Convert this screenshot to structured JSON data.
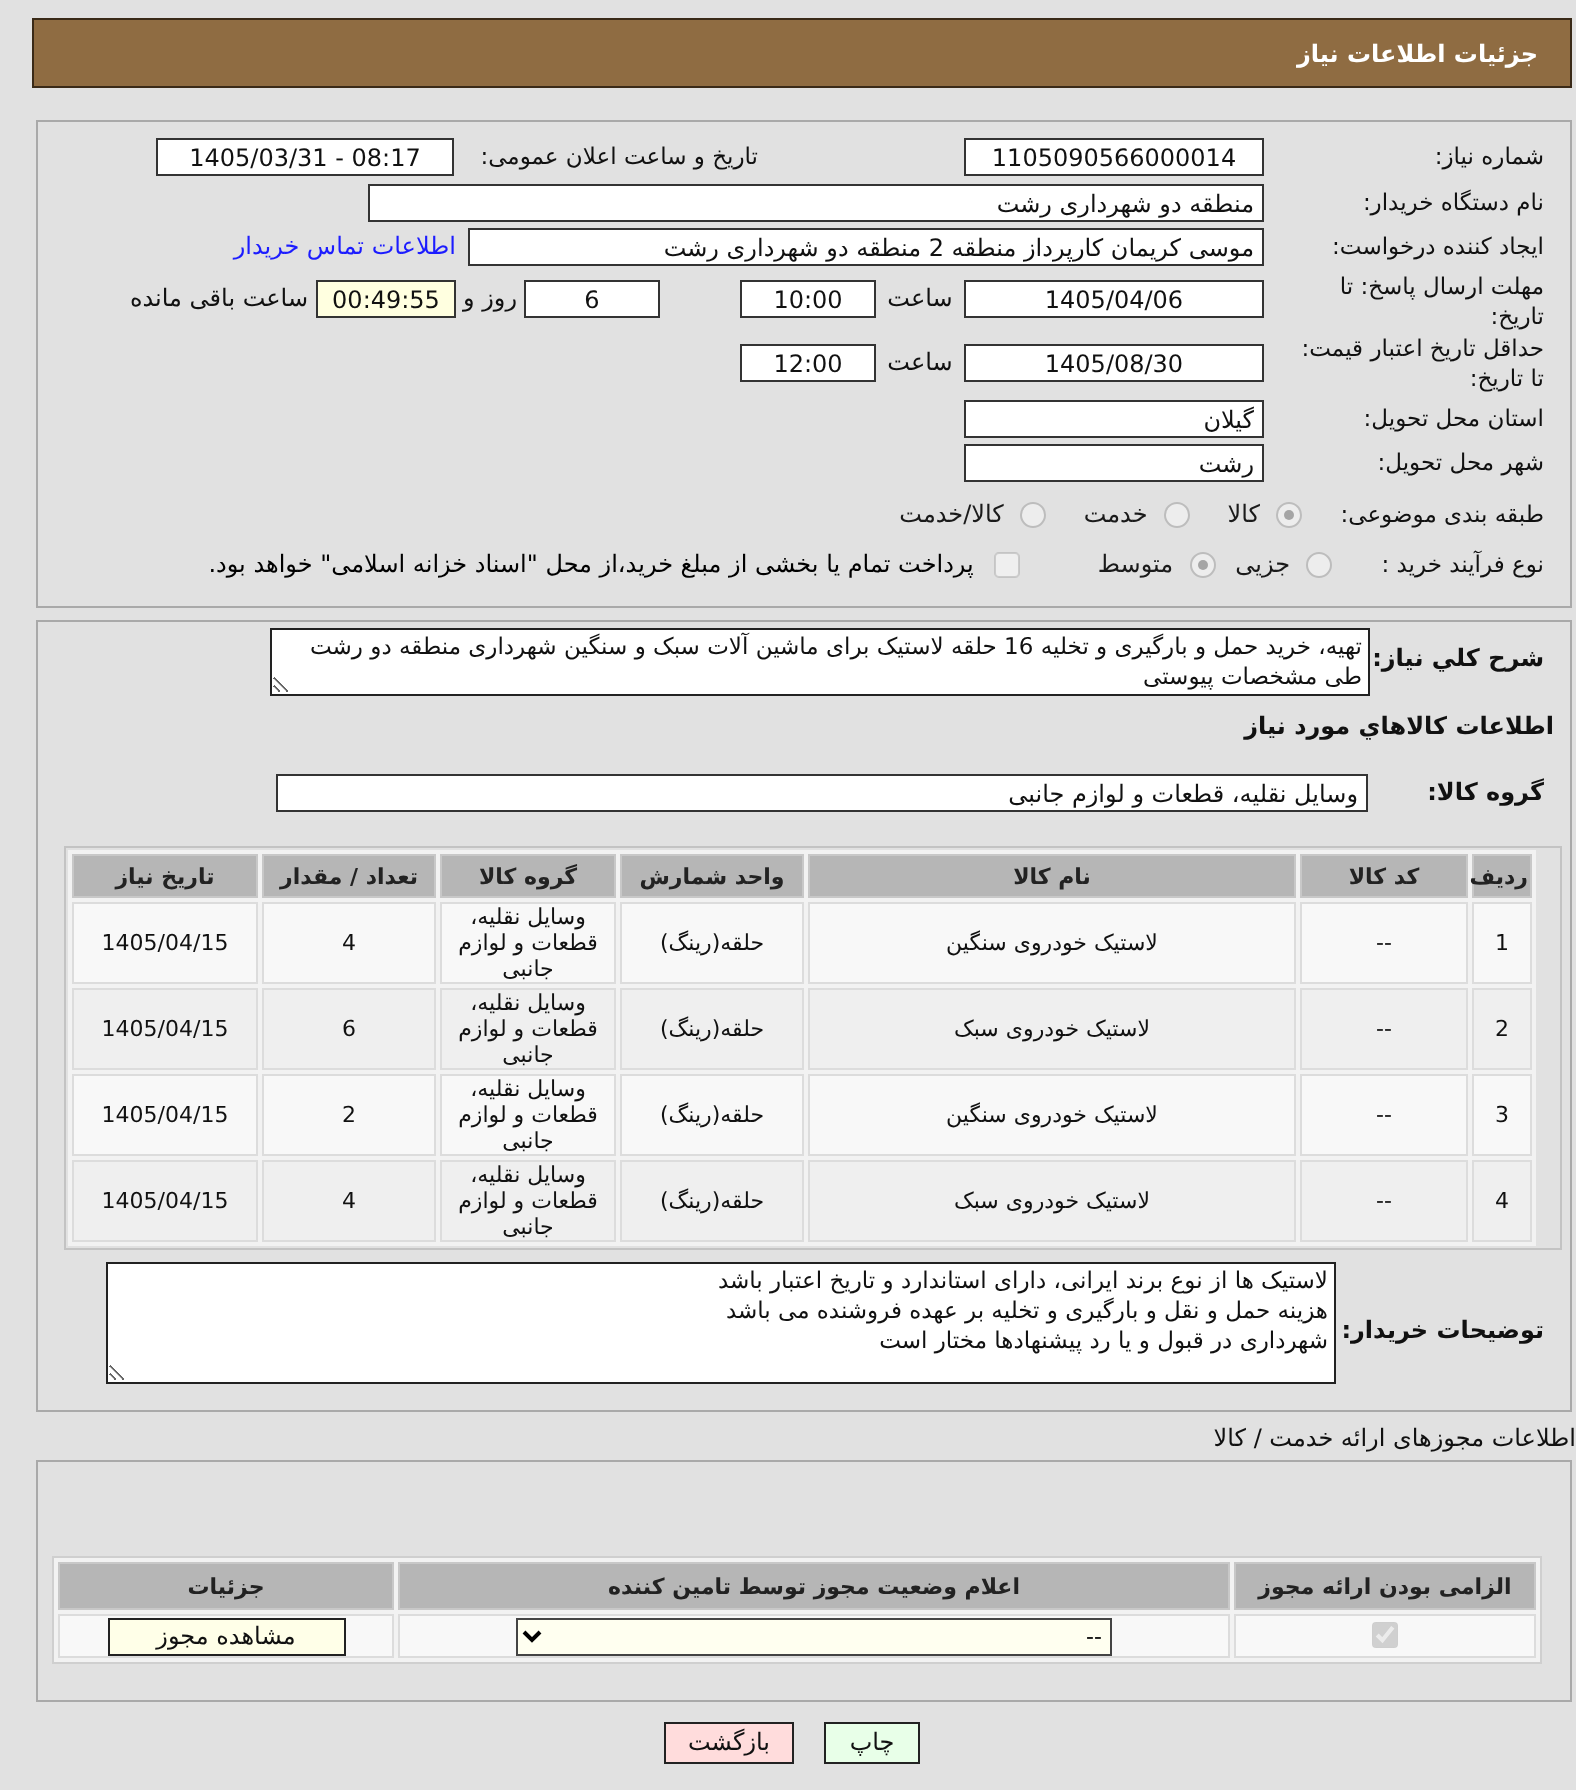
{
  "header": {
    "title": "جزئیات اطلاعات نیاز"
  },
  "details": {
    "need_number": {
      "label": "شماره نیاز:",
      "value": "1105090566000014"
    },
    "announcement": {
      "label": "تاریخ و ساعت اعلان عمومی:",
      "value": "1405/03/31 - 08:17"
    },
    "buyer_org": {
      "label": "نام دستگاه خریدار:",
      "value": "منطقه دو شهرداری رشت"
    },
    "requester": {
      "label": "ایجاد کننده درخواست:",
      "value": "موسی کریمان کارپرداز منطقه 2 منطقه دو شهرداری رشت",
      "contact_link": "اطلاعات تماس خریدار"
    },
    "response_deadline": {
      "label": "مهلت ارسال پاسخ: تا تاریخ:",
      "date": "1405/04/06",
      "time_label": "ساعت",
      "time": "10:00",
      "days": "6",
      "days_label": "روز و",
      "remaining": "00:49:55",
      "remaining_label": "ساعت باقی مانده"
    },
    "price_validity": {
      "label": "حداقل تاریخ اعتبار قیمت: تا تاریخ:",
      "date": "1405/08/30",
      "time_label": "ساعت",
      "time": "12:00"
    },
    "province": {
      "label": "استان محل تحویل:",
      "value": "گیلان"
    },
    "city": {
      "label": "شهر محل تحویل:",
      "value": "رشت"
    },
    "category": {
      "label": "طبقه بندی موضوعی:",
      "disabled": true,
      "options": [
        {
          "label": "کالا",
          "selected": true
        },
        {
          "label": "خدمت",
          "selected": false
        },
        {
          "label": "کالا/خدمت",
          "selected": false
        }
      ]
    },
    "purchase_process": {
      "label": "نوع فرآیند خرید :",
      "disabled": true,
      "options": [
        {
          "label": "جزیی",
          "selected": false
        },
        {
          "label": "متوسط",
          "selected": true
        }
      ],
      "treasury_payment": {
        "label": "پرداخت تمام یا بخشی از مبلغ خرید،از محل \"اسناد خزانه اسلامی\" خواهد بود.",
        "checked": false,
        "disabled": true
      }
    }
  },
  "need": {
    "description": {
      "label": "شرح کلي نياز:",
      "value": "تهیه، خرید حمل و بارگیری و تخلیه 16 حلقه لاستیک برای ماشین آلات سبک و سنگین شهرداری منطقه دو رشت طی مشخصات پیوستی"
    },
    "goods_heading": "اطلاعات کالاهاي مورد نياز",
    "goods_group": {
      "label": "گروه کالا:",
      "value": "وسایل نقلیه، قطعات و لوازم جانبی"
    },
    "goods_table": {
      "columns": [
        "ردیف",
        "کد کالا",
        "نام کالا",
        "واحد شمارش",
        "گروه کالا",
        "تعداد / مقدار",
        "تاریخ نیاز"
      ],
      "rows": [
        [
          "1",
          "--",
          "لاستیک خودروی سنگین",
          "حلقه(رینگ)",
          "وسایل نقلیه، قطعات و لوازم جانبی",
          "4",
          "1405/04/15"
        ],
        [
          "2",
          "--",
          "لاستیک خودروی سبک",
          "حلقه(رینگ)",
          "وسایل نقلیه، قطعات و لوازم جانبی",
          "6",
          "1405/04/15"
        ],
        [
          "3",
          "--",
          "لاستیک خودروی سنگین",
          "حلقه(رینگ)",
          "وسایل نقلیه، قطعات و لوازم جانبی",
          "2",
          "1405/04/15"
        ],
        [
          "4",
          "--",
          "لاستیک خودروی سبک",
          "حلقه(رینگ)",
          "وسایل نقلیه، قطعات و لوازم جانبی",
          "4",
          "1405/04/15"
        ]
      ]
    },
    "buyer_notes": {
      "label": "توضیحات خریدار:",
      "value": "لاستیک ها از نوع برند ایرانی، دارای استاندارد و تاریخ اعتبار باشد\nهزینه حمل و نقل و بارگیری و تخلیه بر عهده فروشنده می باشد\nشهرداری در قبول و یا رد پیشنهادها مختار است"
    }
  },
  "licenses": {
    "title": "اطلاعات مجوزهای ارائه خدمت / کالا",
    "columns": [
      "الزامی بودن ارائه مجوز",
      "اعلام وضعیت مجوز توسط تامین کننده",
      "جزئیات"
    ],
    "rows": [
      {
        "required": {
          "checked": true,
          "disabled": true
        },
        "status": "--",
        "details_button": "مشاهده مجوز"
      }
    ]
  },
  "actions": [
    {
      "label": "چاپ",
      "kind": "print"
    },
    {
      "label": "بازگشت",
      "kind": "back"
    }
  ]
}
